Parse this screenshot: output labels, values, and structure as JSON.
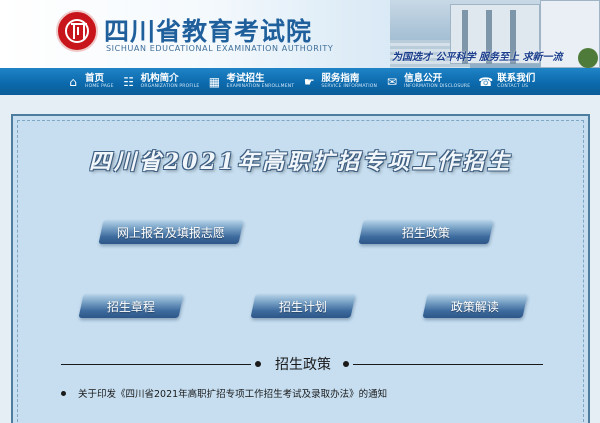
{
  "header": {
    "site_name_cn": "四川省教育考试院",
    "site_name_en": "SICHUAN EDUCATIONAL EXAMINATION AUTHORITY",
    "slogan": "为国选才  公平科学  服务至上  求新一流"
  },
  "nav": {
    "items": [
      {
        "cn": "首页",
        "en": "HOME PAGE",
        "icon": "⌂"
      },
      {
        "cn": "机构简介",
        "en": "ORGANIZATION PROFILE",
        "icon": "☷"
      },
      {
        "cn": "考试招生",
        "en": "EXAMINATION ENROLLMENT",
        "icon": "▦"
      },
      {
        "cn": "服务指南",
        "en": "SERVICE INFORMATION",
        "icon": "☛"
      },
      {
        "cn": "信息公开",
        "en": "INFORMATION DISCLOSURE",
        "icon": "✉"
      },
      {
        "cn": "联系我们",
        "en": "CONTACT US",
        "icon": "☎"
      }
    ]
  },
  "main": {
    "title": "四川省2021年高职扩招专项工作招生",
    "buttons": {
      "online_register": "网上报名及填报志愿",
      "policy": "招生政策",
      "charter": "招生章程",
      "plan": "招生计划",
      "interpretation": "政策解读"
    },
    "section_title": "招生政策",
    "news": [
      "关于印发《四川省2021年高职扩招专项工作招生考试及录取办法》的通知"
    ]
  },
  "colors": {
    "nav_bg": "#0c6aad",
    "panel_bg": "#c6def0",
    "brand_blue": "#1e5f9c",
    "seal_red": "#c8151b"
  }
}
